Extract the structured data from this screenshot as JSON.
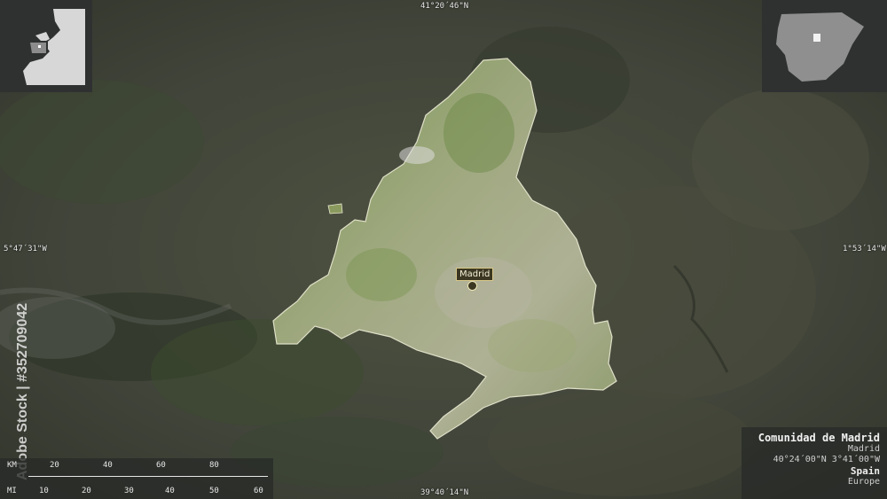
{
  "coords": {
    "top": "41°20´46\"N",
    "bottom": "39°40´14\"N",
    "left": "5°47´31\"W",
    "right": "1°53´14\"W"
  },
  "city": {
    "label": "Madrid"
  },
  "info": {
    "region": "Comunidad de Madrid",
    "capital": "Madrid",
    "coords": "40°24´00\"N 3°41´00\"W",
    "country": "Spain",
    "continent": "Europe"
  },
  "scale": {
    "km_label": "KM",
    "mi_label": "MI",
    "km_ticks": [
      "20",
      "40",
      "60",
      "80"
    ],
    "mi_ticks": [
      "10",
      "20",
      "30",
      "40",
      "50",
      "60"
    ]
  },
  "watermark": "Adobe Stock | #352709042",
  "colors": {
    "terrain_dark": "#3f4334",
    "region_fill": "#8a9a5e",
    "panel_bg": "#282a28"
  }
}
